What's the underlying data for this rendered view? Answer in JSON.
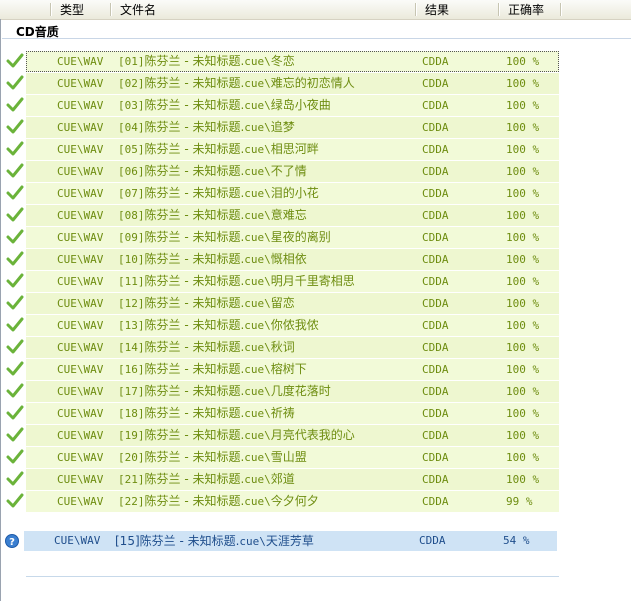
{
  "columns": {
    "type": "类型",
    "filename": "文件名",
    "result": "结果",
    "accuracy": "正确率"
  },
  "group": {
    "title": "CD音质"
  },
  "rows": [
    {
      "type": "CUE\\WAV",
      "prefix": "[01]",
      "artist_title": "陈芬兰 - 未知标题.",
      "ext": "cue\\",
      "track": "冬恋",
      "result": "CDDA",
      "accuracy": "100 %"
    },
    {
      "type": "CUE\\WAV",
      "prefix": "[02]",
      "artist_title": "陈芬兰 - 未知标题.",
      "ext": "cue\\",
      "track": "难忘的初恋情人",
      "result": "CDDA",
      "accuracy": "100 %"
    },
    {
      "type": "CUE\\WAV",
      "prefix": "[03]",
      "artist_title": "陈芬兰 - 未知标题.",
      "ext": "cue\\",
      "track": "绿岛小夜曲",
      "result": "CDDA",
      "accuracy": "100 %"
    },
    {
      "type": "CUE\\WAV",
      "prefix": "[04]",
      "artist_title": "陈芬兰 - 未知标题.",
      "ext": "cue\\",
      "track": "追梦",
      "result": "CDDA",
      "accuracy": "100 %"
    },
    {
      "type": "CUE\\WAV",
      "prefix": "[05]",
      "artist_title": "陈芬兰 - 未知标题.",
      "ext": "cue\\",
      "track": "相思河畔",
      "result": "CDDA",
      "accuracy": "100 %"
    },
    {
      "type": "CUE\\WAV",
      "prefix": "[06]",
      "artist_title": "陈芬兰 - 未知标题.",
      "ext": "cue\\",
      "track": "不了情",
      "result": "CDDA",
      "accuracy": "100 %"
    },
    {
      "type": "CUE\\WAV",
      "prefix": "[07]",
      "artist_title": "陈芬兰 - 未知标题.",
      "ext": "cue\\",
      "track": "泪的小花",
      "result": "CDDA",
      "accuracy": "100 %"
    },
    {
      "type": "CUE\\WAV",
      "prefix": "[08]",
      "artist_title": "陈芬兰 - 未知标题.",
      "ext": "cue\\",
      "track": "意难忘",
      "result": "CDDA",
      "accuracy": "100 %"
    },
    {
      "type": "CUE\\WAV",
      "prefix": "[09]",
      "artist_title": "陈芬兰 - 未知标题.",
      "ext": "cue\\",
      "track": "星夜的离别",
      "result": "CDDA",
      "accuracy": "100 %"
    },
    {
      "type": "CUE\\WAV",
      "prefix": "[10]",
      "artist_title": "陈芬兰 - 未知标题.",
      "ext": "cue\\",
      "track": "慨相依",
      "result": "CDDA",
      "accuracy": "100 %"
    },
    {
      "type": "CUE\\WAV",
      "prefix": "[11]",
      "artist_title": "陈芬兰 - 未知标题.",
      "ext": "cue\\",
      "track": "明月千里寄相思",
      "result": "CDDA",
      "accuracy": "100 %"
    },
    {
      "type": "CUE\\WAV",
      "prefix": "[12]",
      "artist_title": "陈芬兰 - 未知标题.",
      "ext": "cue\\",
      "track": "留恋",
      "result": "CDDA",
      "accuracy": "100 %"
    },
    {
      "type": "CUE\\WAV",
      "prefix": "[13]",
      "artist_title": "陈芬兰 - 未知标题.",
      "ext": "cue\\",
      "track": "你侬我侬",
      "result": "CDDA",
      "accuracy": "100 %"
    },
    {
      "type": "CUE\\WAV",
      "prefix": "[14]",
      "artist_title": "陈芬兰 - 未知标题.",
      "ext": "cue\\",
      "track": "秋词",
      "result": "CDDA",
      "accuracy": "100 %"
    },
    {
      "type": "CUE\\WAV",
      "prefix": "[16]",
      "artist_title": "陈芬兰 - 未知标题.",
      "ext": "cue\\",
      "track": "榕树下",
      "result": "CDDA",
      "accuracy": "100 %"
    },
    {
      "type": "CUE\\WAV",
      "prefix": "[17]",
      "artist_title": "陈芬兰 - 未知标题.",
      "ext": "cue\\",
      "track": "几度花落时",
      "result": "CDDA",
      "accuracy": "100 %"
    },
    {
      "type": "CUE\\WAV",
      "prefix": "[18]",
      "artist_title": "陈芬兰 - 未知标题.",
      "ext": "cue\\",
      "track": "祈祷",
      "result": "CDDA",
      "accuracy": "100 %"
    },
    {
      "type": "CUE\\WAV",
      "prefix": "[19]",
      "artist_title": "陈芬兰 - 未知标题.",
      "ext": "cue\\",
      "track": "月亮代表我的心",
      "result": "CDDA",
      "accuracy": "100 %"
    },
    {
      "type": "CUE\\WAV",
      "prefix": "[20]",
      "artist_title": "陈芬兰 - 未知标题.",
      "ext": "cue\\",
      "track": "雪山盟",
      "result": "CDDA",
      "accuracy": "100 %"
    },
    {
      "type": "CUE\\WAV",
      "prefix": "[21]",
      "artist_title": "陈芬兰 - 未知标题.",
      "ext": "cue\\",
      "track": "郊道",
      "result": "CDDA",
      "accuracy": "100 %"
    },
    {
      "type": "CUE\\WAV",
      "prefix": "[22]",
      "artist_title": "陈芬兰 - 未知标题.",
      "ext": "cue\\",
      "track": "今夕何夕",
      "result": "CDDA",
      "accuracy": "99 %"
    }
  ],
  "pending": {
    "type": "CUE\\WAV",
    "prefix": "[15]",
    "artist_title": "陈芬兰 - 未知标题.",
    "ext": "cue\\",
    "track": "天涯芳草",
    "result": "CDDA",
    "accuracy": "54 %"
  },
  "icons": {
    "done": "check-icon",
    "pending": "question-icon"
  },
  "colors": {
    "done_text": "#6e8d10",
    "row_bg": "#f2fad8",
    "pending_bg": "#cfe3f5",
    "pending_text": "#1f4e8c"
  }
}
